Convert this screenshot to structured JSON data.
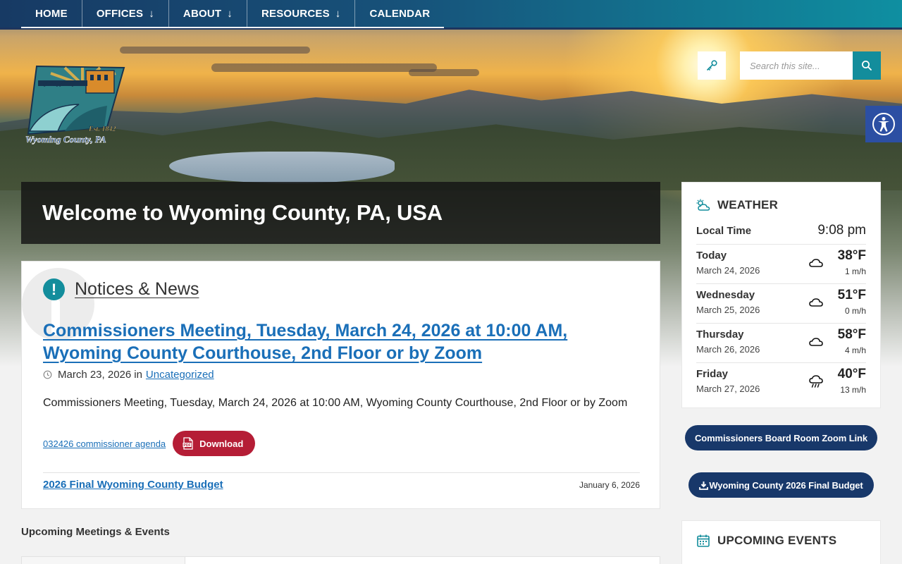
{
  "nav": {
    "items": [
      {
        "label": "HOME",
        "arrow": ""
      },
      {
        "label": "OFFICES",
        "arrow": "↓"
      },
      {
        "label": "ABOUT",
        "arrow": "↓"
      },
      {
        "label": "RESOURCES",
        "arrow": "↓"
      },
      {
        "label": "CALENDAR",
        "arrow": ""
      }
    ]
  },
  "logo": {
    "est": "Est. 1842",
    "name": "Wyoming County, PA"
  },
  "search": {
    "placeholder": "Search this site..."
  },
  "welcome": {
    "title": "Welcome to Wyoming County, PA, USA"
  },
  "notices": {
    "heading": "Notices & News",
    "post": {
      "title": "Commissioners Meeting, Tuesday, March 24, 2026 at 10:00 AM, Wyoming County Courthouse, 2nd Floor or by Zoom",
      "date": "March 23, 2026",
      "in_label": "in",
      "category": "Uncategorized",
      "excerpt": "Commissioners Meeting, Tuesday, March 24, 2026 at 10:00 AM, Wyoming County Courthouse, 2nd Floor or by Zoom",
      "attachment": "032426 commissioner agenda",
      "download_label": "Download"
    },
    "secondary": {
      "title": "2026 Final Wyoming County Budget",
      "date": "January 6, 2026"
    }
  },
  "upcoming_heading": "Upcoming Meetings & Events",
  "weather": {
    "title": "WEATHER",
    "local_time_label": "Local Time",
    "local_time": "9:08 pm",
    "days": [
      {
        "day": "Today",
        "date": "March 24, 2026",
        "temp": "38°F",
        "wind": "1 m/h",
        "icon": "cloud-icon"
      },
      {
        "day": "Wednesday",
        "date": "March 25, 2026",
        "temp": "51°F",
        "wind": "0 m/h",
        "icon": "cloud-icon"
      },
      {
        "day": "Thursday",
        "date": "March 26, 2026",
        "temp": "58°F",
        "wind": "4 m/h",
        "icon": "cloud-icon"
      },
      {
        "day": "Friday",
        "date": "March 27, 2026",
        "temp": "40°F",
        "wind": "13 m/h",
        "icon": "rain-cloud-icon"
      }
    ]
  },
  "buttons": {
    "zoom_link": "Commissioners Board Room Zoom Link",
    "budget": "Wyoming County 2026 Final Budget"
  },
  "events": {
    "title": "UPCOMING EVENTS"
  },
  "colors": {
    "nav_start": "#173a64",
    "nav_end": "#0f8fa1",
    "accent": "#138d9c",
    "download": "#b51d36",
    "pill": "#18386a",
    "link": "#1a6fb8"
  }
}
